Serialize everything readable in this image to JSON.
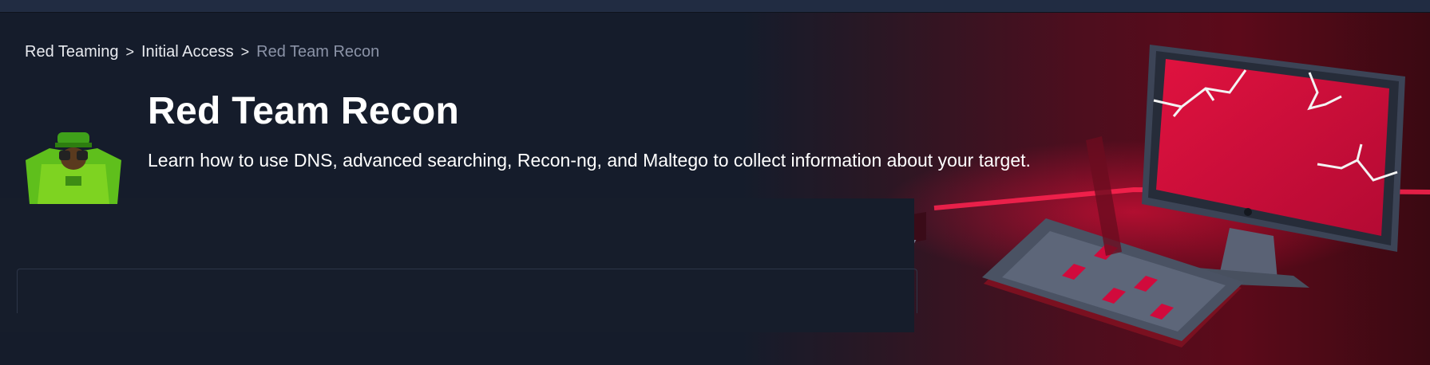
{
  "breadcrumb": {
    "items": [
      "Red Teaming",
      "Initial Access"
    ],
    "separator": ">",
    "current": "Red Team Recon"
  },
  "room": {
    "title": "Red Team Recon",
    "description": "Learn how to use DNS, advanced searching, Recon-ng, and Maltego to collect information about your target."
  },
  "colors": {
    "background": "#161d2b",
    "accent_red": "#d10a3c",
    "avatar_green": "#7ed321"
  },
  "icons": {
    "avatar": "hacker-with-binoculars-icon",
    "hero": "computer-keyboard-lightning-illustration"
  }
}
